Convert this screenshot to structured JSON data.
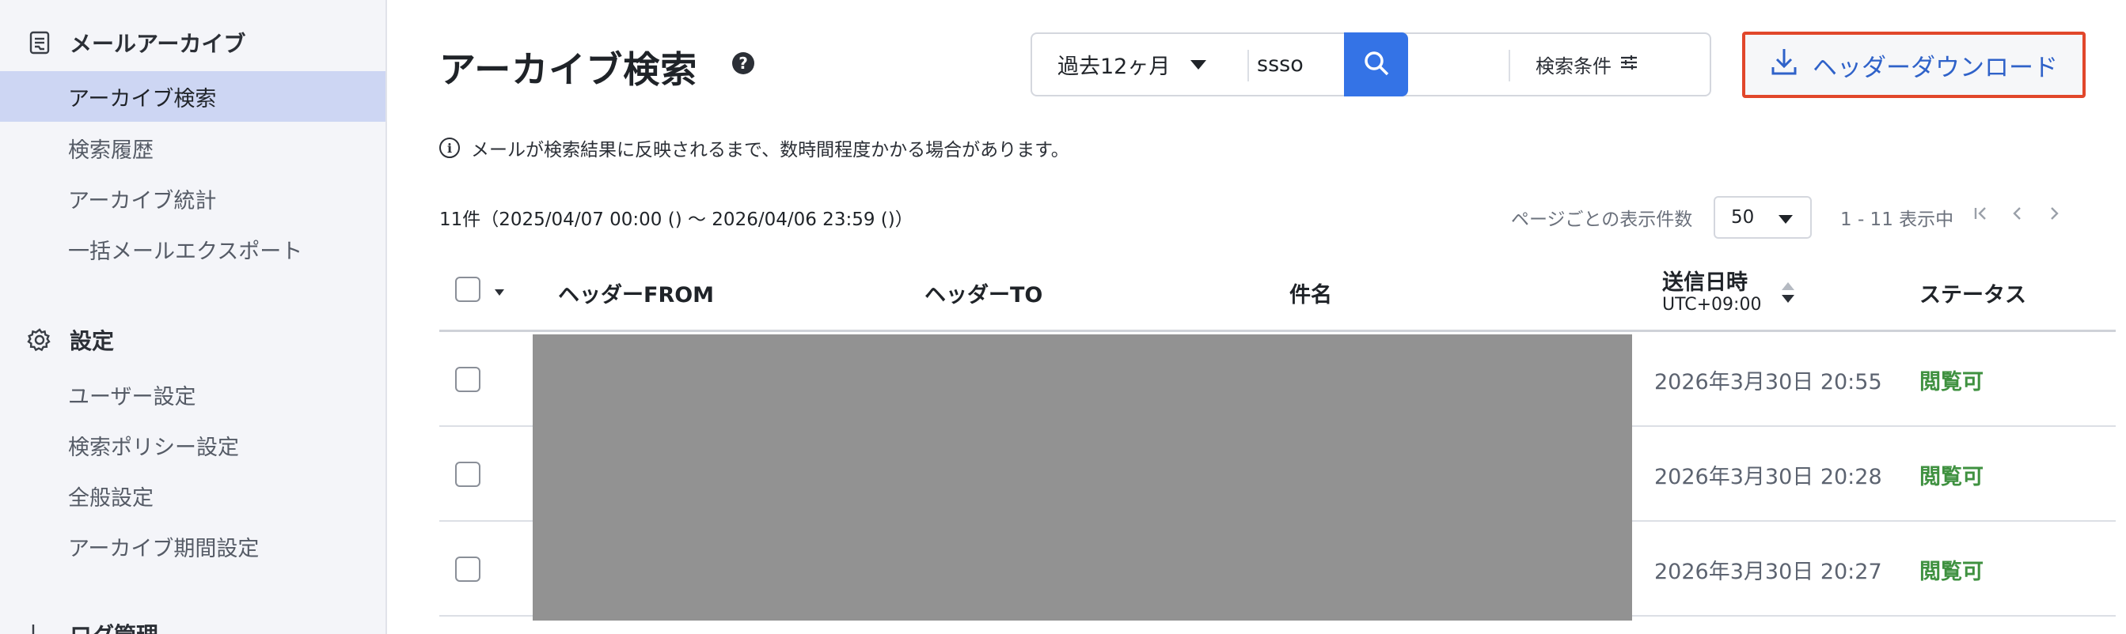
{
  "sidebar": {
    "archive_section": "メールアーカイブ",
    "archive_items": [
      {
        "label": "アーカイブ検索",
        "active": true
      },
      {
        "label": "検索履歴"
      },
      {
        "label": "アーカイブ統計"
      },
      {
        "label": "一括メールエクスポート"
      }
    ],
    "settings_section": "設定",
    "settings_items": [
      {
        "label": "ユーザー設定"
      },
      {
        "label": "検索ポリシー設定"
      },
      {
        "label": "全般設定"
      },
      {
        "label": "アーカイブ期間設定"
      }
    ],
    "log_section": "ログ管理"
  },
  "header": {
    "title": "アーカイブ検索",
    "help_glyph": "?",
    "period": "過去12ヶ月",
    "query": "ssso",
    "conditions_label": "検索条件",
    "download_label": "ヘッダーダウンロード"
  },
  "notice": {
    "icon": "i",
    "text": "メールが検索結果に反映されるまで、数時間程度かかる場合があります。"
  },
  "results": {
    "summary": "11件（2025/04/07 00:00 () 〜 2026/04/06 23:59 ()）",
    "per_page_label": "ページごとの表示件数",
    "per_page": "50",
    "range": "1 - 11 表示中"
  },
  "table": {
    "columns": {
      "from": "ヘッダーFROM",
      "to": "ヘッダーTO",
      "subject": "件名",
      "sent": "送信日時",
      "sent_tz": "UTC+09:00",
      "status": "ステータス"
    },
    "rows": [
      {
        "sent": "2026年3月30日 20:55",
        "status": "閲覧可"
      },
      {
        "sent": "2026年3月30日 20:28",
        "status": "閲覧可"
      },
      {
        "sent": "2026年3月30日 20:27",
        "status": "閲覧可"
      }
    ]
  },
  "colors": {
    "accent": "#3473e6",
    "download_text": "#2f62c9",
    "highlight_border": "#e1472b",
    "status_ok": "#3f9140",
    "sidebar_active": "#cdd6f3"
  }
}
